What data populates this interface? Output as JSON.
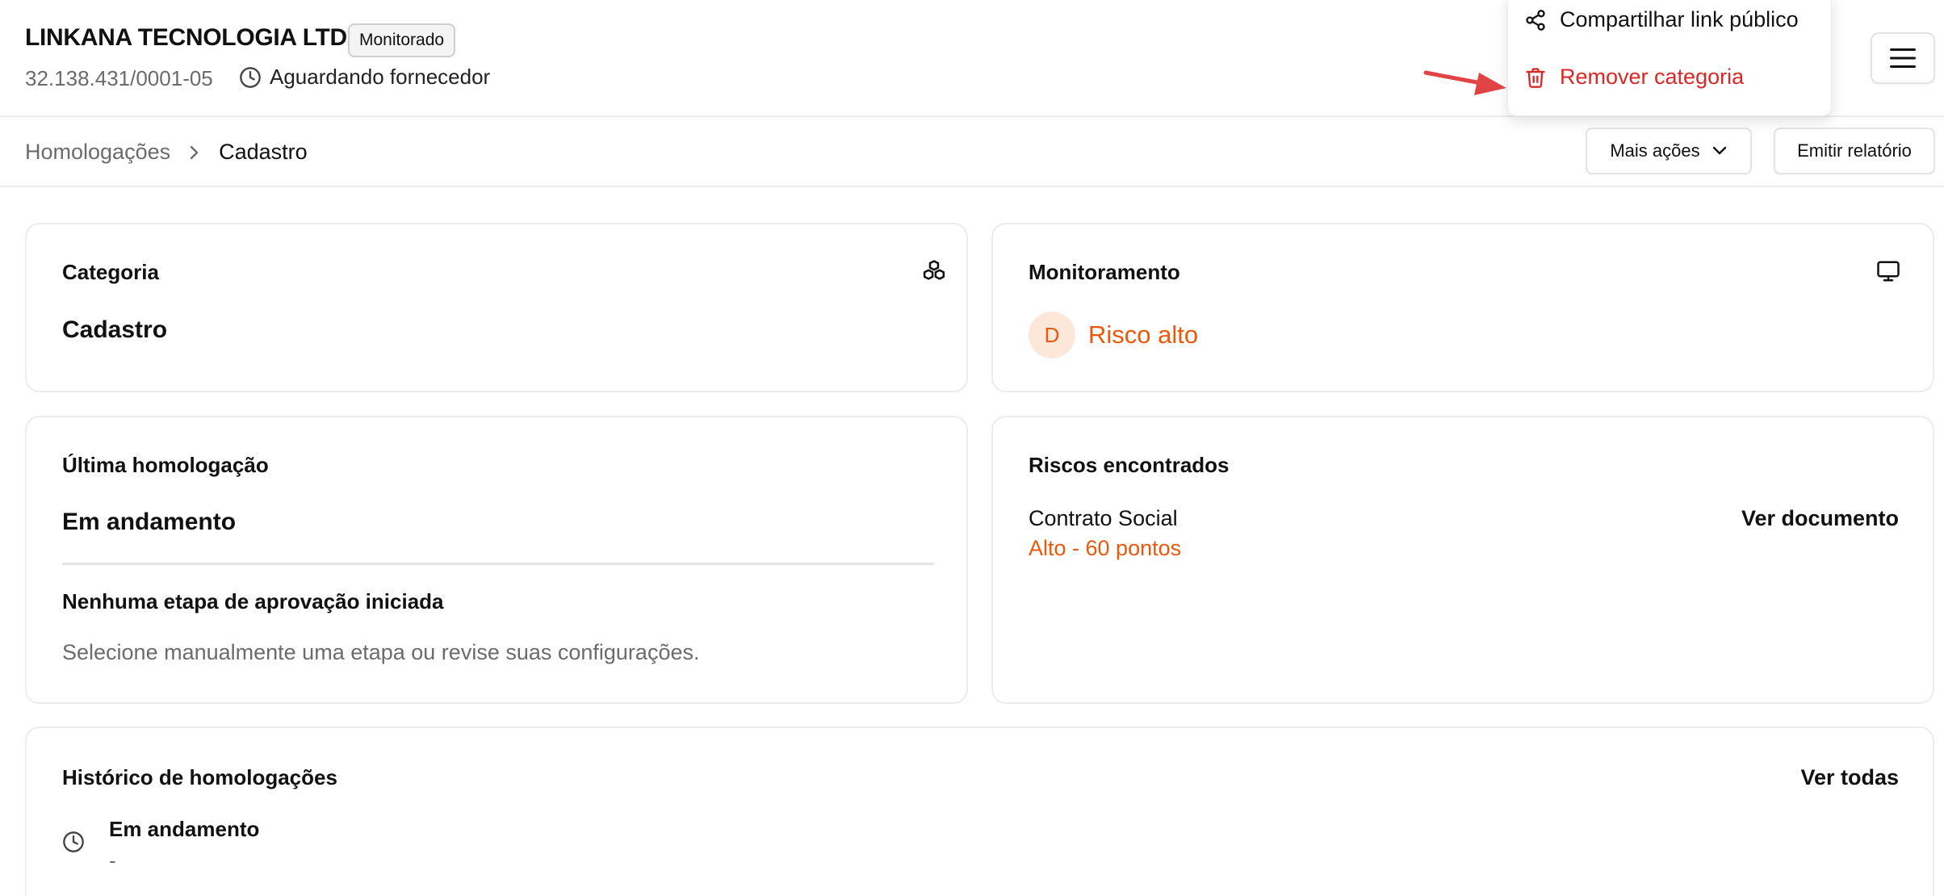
{
  "header": {
    "company_name": "LINKANA TECNOLOGIA LTDA",
    "status_badge": "Monitorado",
    "cnpj": "32.138.431/0001-05",
    "supplier_status": "Aguardando fornecedor",
    "menu_icon": "hamburger-icon"
  },
  "dropdown": {
    "items": [
      {
        "label": "Compartilhar link público",
        "icon": "share-icon"
      },
      {
        "label": "Remover categoria",
        "icon": "trash-icon",
        "color": "#dc2626"
      }
    ]
  },
  "breadcrumb": {
    "items": [
      "Homologações",
      "Cadastro"
    ]
  },
  "toolbar": {
    "more_actions": "Mais ações",
    "emit_report": "Emitir relatório"
  },
  "cards": {
    "categoria": {
      "title": "Categoria",
      "value": "Cadastro",
      "icon": "cubes-icon"
    },
    "monitoramento": {
      "title": "Monitoramento",
      "grade": "D",
      "risk": "Risco alto",
      "icon": "monitor-icon",
      "accent": "#ea580c"
    },
    "ultima": {
      "title": "Última homologação",
      "value": "Em andamento",
      "subtitle": "Nenhuma etapa de aprovação iniciada",
      "description": "Selecione manualmente uma etapa ou revise suas configurações."
    },
    "riscos": {
      "title": "Riscos encontrados",
      "document": "Contrato Social",
      "level": "Alto - 60 pontos",
      "action": "Ver documento"
    },
    "historico": {
      "title": "Histórico de homologações",
      "action": "Ver todas",
      "item_title": "Em andamento",
      "item_sub": "-"
    }
  }
}
